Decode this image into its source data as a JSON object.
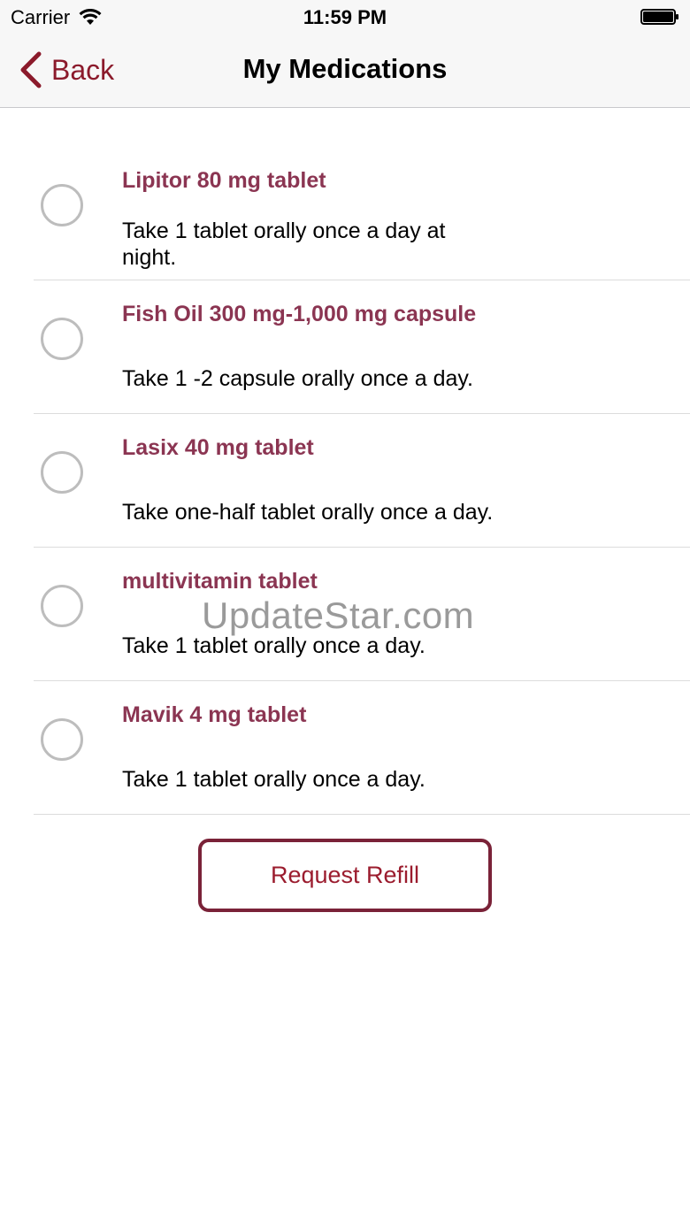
{
  "status_bar": {
    "carrier": "Carrier",
    "time": "11:59 PM",
    "wifi_icon": "wifi-icon",
    "battery_icon": "battery-icon"
  },
  "nav": {
    "back_label": "Back",
    "title": "My Medications",
    "back_icon": "chevron-left-icon"
  },
  "medications": [
    {
      "name": "Lipitor 80 mg tablet",
      "instructions": "Take 1 tablet orally once a day at night.",
      "selected": false
    },
    {
      "name": "Fish Oil 300 mg-1,000 mg capsule",
      "instructions": "Take 1 -2 capsule orally once a day.",
      "selected": false
    },
    {
      "name": "Lasix 40 mg tablet",
      "instructions": "Take one-half tablet orally once a day.",
      "selected": false
    },
    {
      "name": "multivitamin tablet",
      "instructions": "Take 1 tablet orally once a day.",
      "selected": false
    },
    {
      "name": "Mavik 4 mg tablet",
      "instructions": "Take 1 tablet orally once a day.",
      "selected": false
    }
  ],
  "refill_button_label": "Request Refill",
  "watermark": "UpdateStar.com",
  "colors": {
    "accent": "#8b1a2b",
    "med_name": "#8b3552",
    "button_border": "#7a2238"
  }
}
